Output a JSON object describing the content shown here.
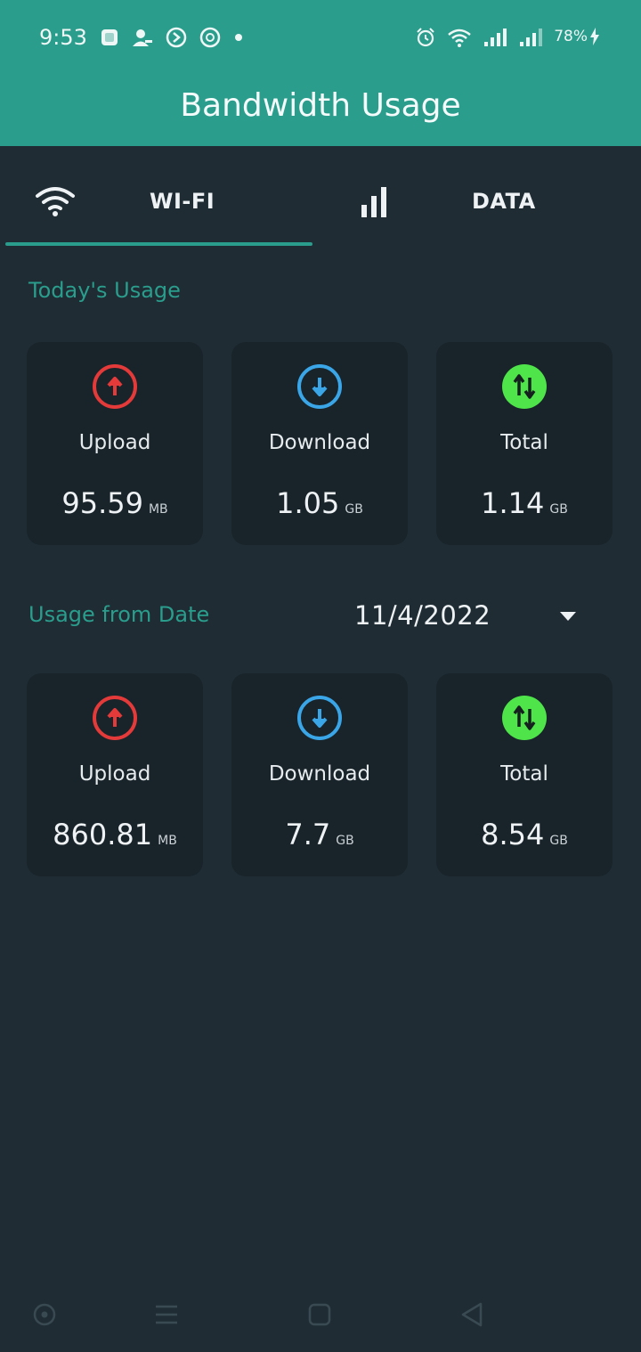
{
  "status_bar": {
    "time": "9:53",
    "battery": "78%",
    "icons": [
      "image-icon",
      "person-icon",
      "circle-arrow-icon",
      "circle-b-icon",
      "dot-icon",
      "alarm-icon",
      "wifi-icon",
      "signal-icon",
      "signal-icon",
      "charging-icon"
    ]
  },
  "app_bar": {
    "title": "Bandwidth Usage"
  },
  "tabs": [
    {
      "label": "WI-FI",
      "icon": "wifi-icon",
      "selected": true
    },
    {
      "label": "DATA",
      "icon": "signal-bars-icon",
      "selected": false
    }
  ],
  "today": {
    "title": "Today's Usage",
    "cards": [
      {
        "label": "Upload",
        "value": "95.59",
        "unit": "MB",
        "icon": "upload-arrow-icon",
        "color": "#e53a3a"
      },
      {
        "label": "Download",
        "value": "1.05",
        "unit": "GB",
        "icon": "download-arrow-icon",
        "color": "#3aa6e8"
      },
      {
        "label": "Total",
        "value": "1.14",
        "unit": "GB",
        "icon": "up-down-arrows-icon",
        "color": "#4ee44a"
      }
    ]
  },
  "from_date": {
    "title": "Usage from Date",
    "selected_date": "11/4/2022",
    "cards": [
      {
        "label": "Upload",
        "value": "860.81",
        "unit": "MB",
        "icon": "upload-arrow-icon",
        "color": "#e53a3a"
      },
      {
        "label": "Download",
        "value": "7.7",
        "unit": "GB",
        "icon": "download-arrow-icon",
        "color": "#3aa6e8"
      },
      {
        "label": "Total",
        "value": "8.54",
        "unit": "GB",
        "icon": "up-down-arrows-icon",
        "color": "#4ee44a"
      }
    ]
  },
  "colors": {
    "accent": "#2a9d8c",
    "background": "#1f2c34",
    "card": "#19242a"
  },
  "nav_bar": {
    "icons": [
      "assistant-icon",
      "recents-icon",
      "home-icon",
      "back-icon"
    ]
  }
}
